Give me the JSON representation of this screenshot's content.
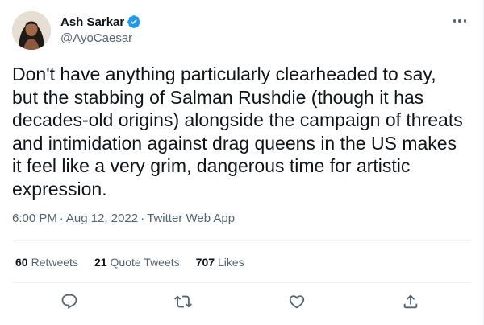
{
  "author": {
    "name": "Ash Sarkar",
    "handle": "@AyoCaesar",
    "verified": true
  },
  "tweet": {
    "text": "Don't have anything particularly clearheaded to say,\nbut the stabbing of Salman Rushdie (though it has\ndecades-old origins) alongside the campaign of threats\nand intimidation against drag queens in the US makes\nit feel like a very grim, dangerous time for artistic\nexpression.",
    "time": "6:00 PM",
    "date": "Aug 12, 2022",
    "source": "Twitter Web App",
    "separator": "·"
  },
  "stats": {
    "retweets_count": "60",
    "retweets_label": "Retweets",
    "quotes_count": "21",
    "quotes_label": "Quote Tweets",
    "likes_count": "707",
    "likes_label": "Likes"
  },
  "icons": {
    "reply": "reply-icon",
    "retweet": "retweet-icon",
    "like": "like-icon",
    "share": "share-icon",
    "more": "more-icon",
    "verified": "verified-badge-icon"
  },
  "colors": {
    "verified_blue": "#1d9bf0",
    "secondary_text": "#536471",
    "primary_text": "#0f1419",
    "divider": "#eff3f4"
  }
}
